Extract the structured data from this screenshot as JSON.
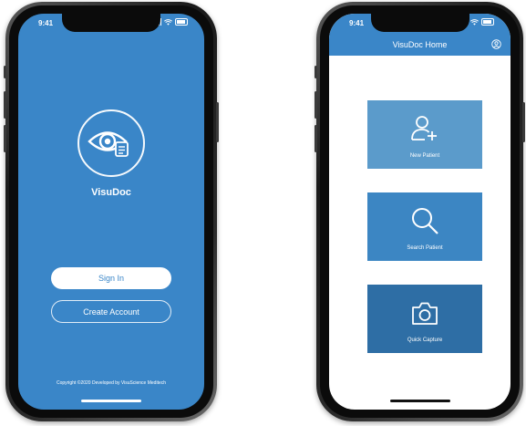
{
  "left_phone": {
    "status_time": "9:41",
    "app_name": "VisuDoc",
    "sign_in_label": "Sign In",
    "create_account_label": "Create Account",
    "copyright": "Copyright ©2020 Developed by VisuScience Meditech",
    "logo_icon": "eye-document-icon",
    "background_color": "#3a86c8"
  },
  "right_phone": {
    "status_time": "9:41",
    "header_title": "VisuDoc Home",
    "profile_icon": "user-circle-icon",
    "tiles": [
      {
        "label": "New Patient",
        "icon": "add-user-icon",
        "color": "#5b9bcb"
      },
      {
        "label": "Search Patient",
        "icon": "search-icon",
        "color": "#3c86c3"
      },
      {
        "label": "Quick Capture",
        "icon": "camera-icon",
        "color": "#2e6ea5"
      }
    ]
  }
}
